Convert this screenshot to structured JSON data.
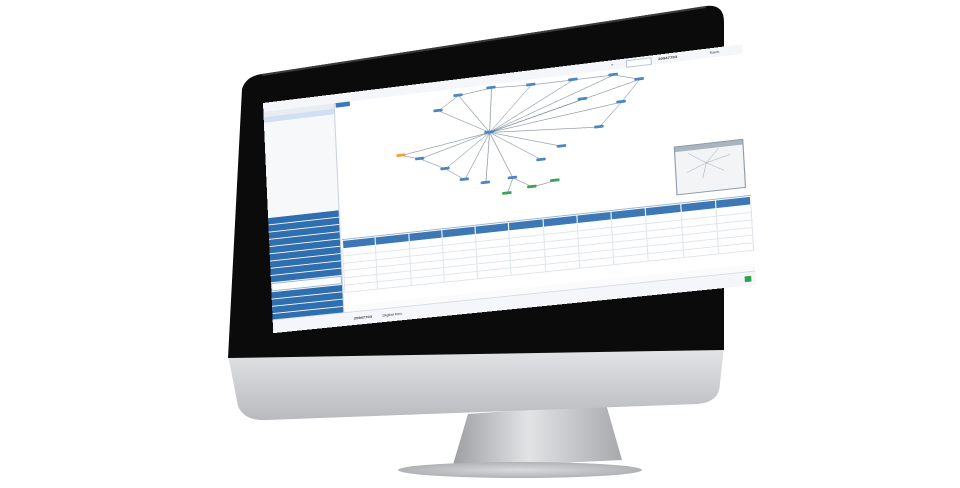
{
  "image": {
    "subject": "Desktop all-in-one monitor displaying a traceability application",
    "colors": {
      "bezel": "#0b0b0b",
      "aluminum": "#c9cbce",
      "stand": "#b9bbbe",
      "accent": "#2f6fb0",
      "status_ok": "#2fa14f"
    }
  },
  "app": {
    "toolbar": {
      "back_label": "Back",
      "search_value": "",
      "current_item": "20947703"
    },
    "status": {
      "current_item": "20947703",
      "view_label": "Digital Rec"
    }
  }
}
